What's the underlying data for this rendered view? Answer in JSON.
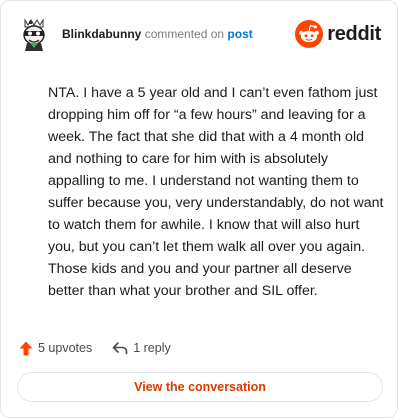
{
  "header": {
    "username": "Blinkdabunny",
    "action_text": "commented on",
    "post_link_text": "post",
    "brand_text": "reddit"
  },
  "comment": {
    "body": "NTA. I have a 5 year old and I can’t even fathom just dropping him off for “a few hours” and leaving for a week. The fact that she did that with a 4 month old and nothing to care for him with is absolutely appalling to me. I understand not wanting them to suffer because you, very understandably, do not want to watch them for awhile. I know that will also hurt you, but you can’t let them walk all over you again. Those kids and you and your partner all deserve better than what your brother and SIL offer."
  },
  "footer": {
    "upvotes_text": "5 upvotes",
    "replies_text": "1 reply"
  },
  "cta": {
    "label": "View the conversation"
  },
  "icons": {
    "avatar": "avatar",
    "brand": "reddit-logo-icon",
    "upvote": "upvote-arrow-icon",
    "reply": "reply-arrow-icon"
  },
  "colors": {
    "brand_orange": "#ff4500",
    "link_blue": "#0079d3",
    "cta_text": "#d93a00",
    "border": "#e3e6e8"
  }
}
